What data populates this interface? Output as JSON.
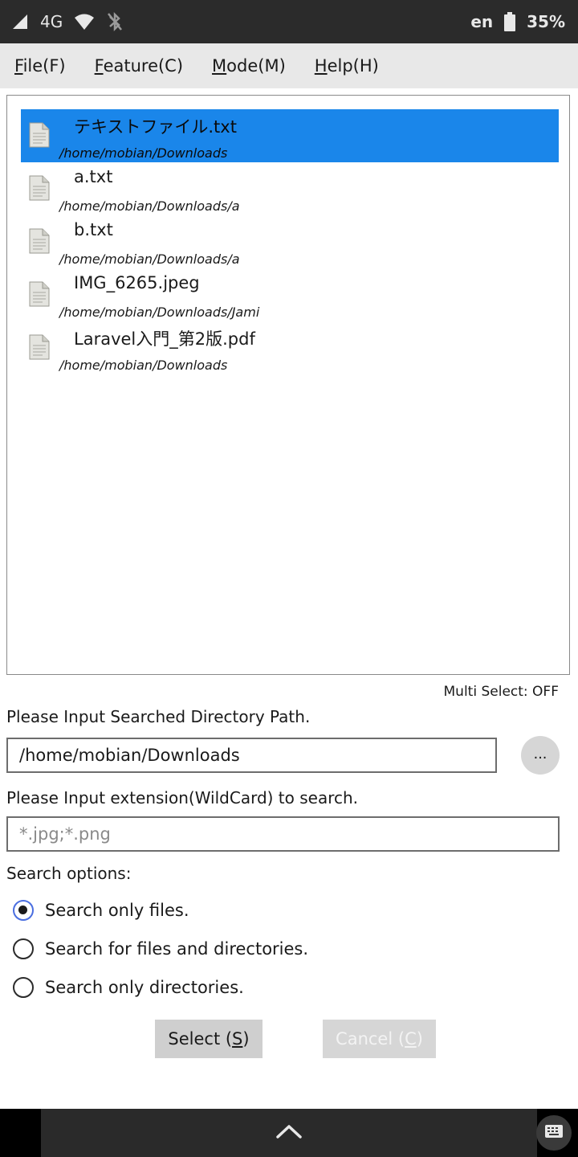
{
  "status_bar": {
    "network": "4G",
    "language": "en",
    "battery": "35%"
  },
  "menu": [
    {
      "pre": "",
      "key": "F",
      "post": "ile(F)"
    },
    {
      "pre": "",
      "key": "F",
      "post": "eature(C)"
    },
    {
      "pre": "",
      "key": "M",
      "post": "ode(M)"
    },
    {
      "pre": "",
      "key": "H",
      "post": "elp(H)"
    }
  ],
  "files": [
    {
      "name": "テキストファイル.txt",
      "path": "/home/mobian/Downloads",
      "selected": true
    },
    {
      "name": "a.txt",
      "path": "/home/mobian/Downloads/a",
      "selected": false
    },
    {
      "name": "b.txt",
      "path": "/home/mobian/Downloads/a",
      "selected": false
    },
    {
      "name": "IMG_6265.jpeg",
      "path": "/home/mobian/Downloads/Jami",
      "selected": false
    },
    {
      "name": "Laravel入門_第2版.pdf",
      "path": "/home/mobian/Downloads",
      "selected": false
    }
  ],
  "multi_select": "Multi Select: OFF",
  "directory": {
    "label": "Please Input Searched Directory Path.",
    "value": "/home/mobian/Downloads",
    "browse_label": "..."
  },
  "extension": {
    "label": "Please Input extension(WildCard) to search.",
    "value": "",
    "placeholder": "*.jpg;*.png"
  },
  "search_options": {
    "label": "Search options:",
    "options": [
      {
        "label": "Search only files.",
        "checked": true
      },
      {
        "label": "Search for files and directories.",
        "checked": false
      },
      {
        "label": "Search only directories.",
        "checked": false
      }
    ]
  },
  "buttons": {
    "select": {
      "pre": "Select (",
      "key": "S",
      "post": ")"
    },
    "cancel": {
      "pre": "Cancel (",
      "key": "C",
      "post": ")"
    }
  },
  "colors": {
    "selection": "#1a86ea",
    "radio_accent": "#4a6ee0"
  }
}
